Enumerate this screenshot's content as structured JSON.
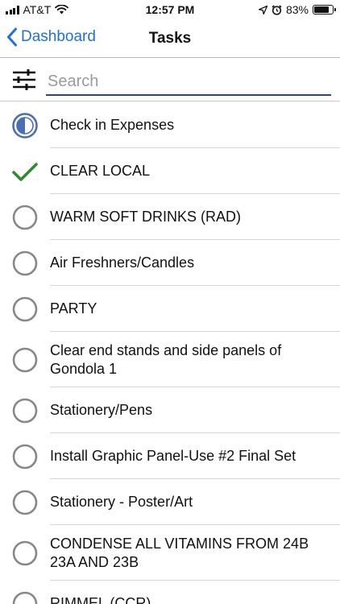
{
  "status_bar": {
    "carrier": "AT&T",
    "time": "12:57 PM",
    "battery_percent": "83%",
    "battery_level": 0.83,
    "icons": [
      "signal-icon",
      "wifi-icon",
      "location-icon",
      "alarm-icon",
      "battery-icon"
    ]
  },
  "nav": {
    "back_label": "Dashboard",
    "title": "Tasks"
  },
  "search": {
    "placeholder": "Search",
    "value": ""
  },
  "colors": {
    "accent": "#1f6fe0",
    "underline": "#2b3cc4",
    "check": "#2e8a2e",
    "circle": "#888888",
    "partial": "#4a6fb5"
  },
  "tasks": [
    {
      "label": "Check in Expenses",
      "state": "partial"
    },
    {
      "label": "CLEAR LOCAL",
      "state": "done"
    },
    {
      "label": "WARM SOFT DRINKS (RAD)",
      "state": "open"
    },
    {
      "label": "Air Freshners/Candles",
      "state": "open"
    },
    {
      "label": "PARTY",
      "state": "open"
    },
    {
      "label": "Clear end stands and side panels of Gondola 1",
      "state": "open"
    },
    {
      "label": "Stationery/Pens",
      "state": "open"
    },
    {
      "label": "Install Graphic Panel-Use #2 Final Set",
      "state": "open"
    },
    {
      "label": "Stationery - Poster/Art",
      "state": "open"
    },
    {
      "label": "CONDENSE ALL VITAMINS FROM 24B 23A AND 23B",
      "state": "open"
    },
    {
      "label": "RIMMEL (CCR)",
      "state": "open"
    }
  ]
}
